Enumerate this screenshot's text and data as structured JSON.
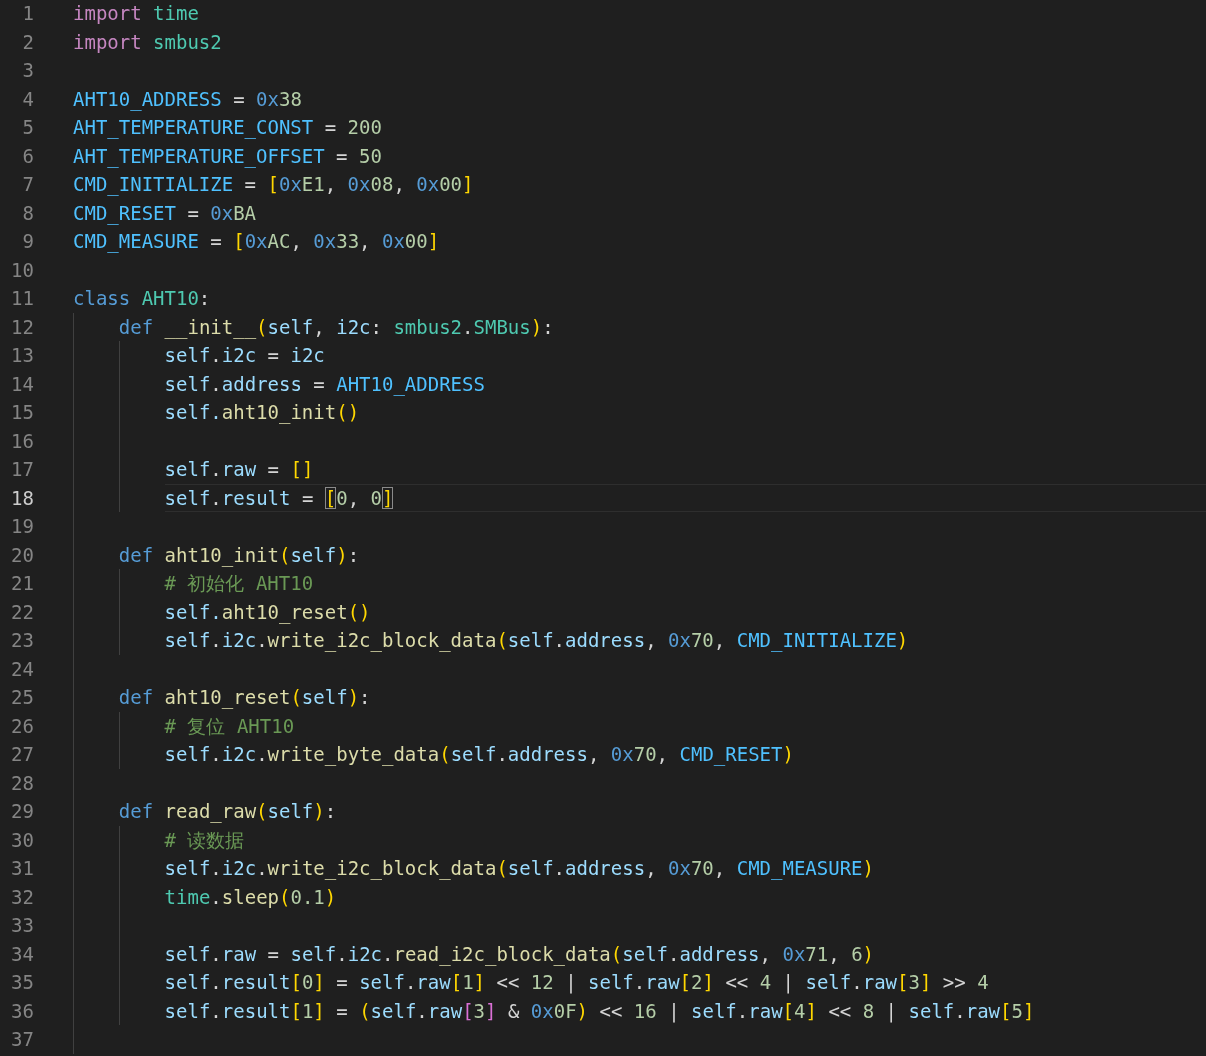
{
  "editor": {
    "lines": [
      {
        "number": "1",
        "current": false,
        "tokens": [
          {
            "kind": "k",
            "text": "import "
          },
          {
            "kind": "m",
            "text": "time"
          }
        ]
      },
      {
        "number": "2",
        "current": false,
        "tokens": [
          {
            "kind": "k",
            "text": "import "
          },
          {
            "kind": "m",
            "text": "smbus2"
          }
        ]
      },
      {
        "number": "3",
        "current": false
      },
      {
        "number": "4",
        "current": false,
        "tokens": [
          {
            "kind": "c",
            "text": "AHT10_ADDRESS"
          },
          {
            "kind": "p",
            "text": " = "
          },
          {
            "kind": "x",
            "text": "0x"
          },
          {
            "kind": "n",
            "text": "38"
          }
        ]
      },
      {
        "number": "5",
        "current": false,
        "tokens": [
          {
            "kind": "c",
            "text": "AHT_TEMPERATURE_CONST"
          },
          {
            "kind": "p",
            "text": " = "
          },
          {
            "kind": "n",
            "text": "200"
          }
        ]
      },
      {
        "number": "6",
        "current": false,
        "tokens": [
          {
            "kind": "c",
            "text": "AHT_TEMPERATURE_OFFSET"
          },
          {
            "kind": "p",
            "text": " = "
          },
          {
            "kind": "n",
            "text": "50"
          }
        ]
      },
      {
        "number": "7",
        "current": false,
        "tokens": [
          {
            "kind": "c",
            "text": "CMD_INITIALIZE"
          },
          {
            "kind": "p",
            "text": " = "
          },
          {
            "kind": "b1",
            "text": "["
          },
          {
            "kind": "x",
            "text": "0x"
          },
          {
            "kind": "n",
            "text": "E1"
          },
          {
            "kind": "p",
            "text": ", "
          },
          {
            "kind": "x",
            "text": "0x"
          },
          {
            "kind": "n",
            "text": "08"
          },
          {
            "kind": "p",
            "text": ", "
          },
          {
            "kind": "x",
            "text": "0x"
          },
          {
            "kind": "n",
            "text": "00"
          },
          {
            "kind": "b1",
            "text": "]"
          }
        ]
      },
      {
        "number": "8",
        "current": false,
        "tokens": [
          {
            "kind": "c",
            "text": "CMD_RESET"
          },
          {
            "kind": "p",
            "text": " = "
          },
          {
            "kind": "x",
            "text": "0x"
          },
          {
            "kind": "n",
            "text": "BA"
          }
        ]
      },
      {
        "number": "9",
        "current": false,
        "tokens": [
          {
            "kind": "c",
            "text": "CMD_MEASURE"
          },
          {
            "kind": "p",
            "text": " = "
          },
          {
            "kind": "b1",
            "text": "["
          },
          {
            "kind": "x",
            "text": "0x"
          },
          {
            "kind": "n",
            "text": "AC"
          },
          {
            "kind": "p",
            "text": ", "
          },
          {
            "kind": "x",
            "text": "0x"
          },
          {
            "kind": "n",
            "text": "33"
          },
          {
            "kind": "p",
            "text": ", "
          },
          {
            "kind": "x",
            "text": "0x"
          },
          {
            "kind": "n",
            "text": "00"
          },
          {
            "kind": "b1",
            "text": "]"
          }
        ]
      },
      {
        "number": "10",
        "current": false
      },
      {
        "number": "11",
        "current": false,
        "tokens": [
          {
            "kind": "s",
            "text": "class "
          },
          {
            "kind": "m",
            "text": "AHT10"
          },
          {
            "kind": "p",
            "text": ":"
          }
        ],
        "children": [
          {
            "number": "12",
            "current": false,
            "tokens": [
              {
                "kind": "s",
                "text": "def "
              },
              {
                "kind": "f",
                "text": "__init__"
              },
              {
                "kind": "b1",
                "text": "("
              },
              {
                "kind": "v",
                "text": "self"
              },
              {
                "kind": "p",
                "text": ", "
              },
              {
                "kind": "v",
                "text": "i2c"
              },
              {
                "kind": "p",
                "text": ": "
              },
              {
                "kind": "m",
                "text": "smbus2"
              },
              {
                "kind": "p",
                "text": "."
              },
              {
                "kind": "m",
                "text": "SMBus"
              },
              {
                "kind": "b1",
                "text": ")"
              },
              {
                "kind": "p",
                "text": ":"
              }
            ],
            "children": [
              {
                "number": "13",
                "current": false,
                "tokens": [
                  {
                    "kind": "v",
                    "text": "self"
                  },
                  {
                    "kind": "p",
                    "text": "."
                  },
                  {
                    "kind": "v",
                    "text": "i2c"
                  },
                  {
                    "kind": "p",
                    "text": " = "
                  },
                  {
                    "kind": "v",
                    "text": "i2c"
                  }
                ]
              },
              {
                "number": "14",
                "current": false,
                "tokens": [
                  {
                    "kind": "v",
                    "text": "self"
                  },
                  {
                    "kind": "p",
                    "text": "."
                  },
                  {
                    "kind": "v",
                    "text": "address"
                  },
                  {
                    "kind": "p",
                    "text": " = "
                  },
                  {
                    "kind": "c",
                    "text": "AHT10_ADDRESS"
                  }
                ]
              },
              {
                "number": "15",
                "current": false,
                "tokens": [
                  {
                    "kind": "v",
                    "text": "self."
                  },
                  {
                    "kind": "f",
                    "text": "aht10_init"
                  },
                  {
                    "kind": "b1",
                    "text": "()"
                  }
                ]
              },
              {
                "number": "16",
                "current": false
              },
              {
                "number": "17",
                "current": false,
                "tokens": [
                  {
                    "kind": "v",
                    "text": "self"
                  },
                  {
                    "kind": "p",
                    "text": "."
                  },
                  {
                    "kind": "v",
                    "text": "raw"
                  },
                  {
                    "kind": "p",
                    "text": " = "
                  },
                  {
                    "kind": "b1",
                    "text": "[]"
                  }
                ]
              },
              {
                "number": "18",
                "current": true,
                "tokens": [
                  {
                    "kind": "v",
                    "text": "self"
                  },
                  {
                    "kind": "p",
                    "text": "."
                  },
                  {
                    "kind": "v",
                    "text": "result"
                  },
                  {
                    "kind": "p",
                    "text": " = "
                  },
                  {
                    "kind": "b1",
                    "text": "[",
                    "matched": true
                  },
                  {
                    "kind": "n",
                    "text": "0"
                  },
                  {
                    "kind": "p",
                    "text": ", "
                  },
                  {
                    "kind": "n",
                    "text": "0"
                  },
                  {
                    "kind": "b1",
                    "text": "]",
                    "matched": true
                  }
                ]
              }
            ]
          },
          {
            "number": "19",
            "current": false
          },
          {
            "number": "20",
            "current": false,
            "tokens": [
              {
                "kind": "s",
                "text": "def "
              },
              {
                "kind": "f",
                "text": "aht10_init"
              },
              {
                "kind": "b1",
                "text": "("
              },
              {
                "kind": "v",
                "text": "self"
              },
              {
                "kind": "b1",
                "text": ")"
              },
              {
                "kind": "p",
                "text": ":"
              }
            ],
            "children": [
              {
                "number": "21",
                "current": false,
                "tokens": [
                  {
                    "kind": "cm",
                    "text": "# 初始化 AHT10"
                  }
                ]
              },
              {
                "number": "22",
                "current": false,
                "tokens": [
                  {
                    "kind": "v",
                    "text": "self."
                  },
                  {
                    "kind": "f",
                    "text": "aht10_reset"
                  },
                  {
                    "kind": "b1",
                    "text": "()"
                  }
                ]
              },
              {
                "number": "23",
                "current": false,
                "tokens": [
                  {
                    "kind": "v",
                    "text": "self"
                  },
                  {
                    "kind": "p",
                    "text": "."
                  },
                  {
                    "kind": "v",
                    "text": "i2c"
                  },
                  {
                    "kind": "p",
                    "text": "."
                  },
                  {
                    "kind": "f",
                    "text": "write_i2c_block_data"
                  },
                  {
                    "kind": "b1",
                    "text": "("
                  },
                  {
                    "kind": "v",
                    "text": "self"
                  },
                  {
                    "kind": "p",
                    "text": "."
                  },
                  {
                    "kind": "v",
                    "text": "address"
                  },
                  {
                    "kind": "p",
                    "text": ", "
                  },
                  {
                    "kind": "x",
                    "text": "0x"
                  },
                  {
                    "kind": "n",
                    "text": "70"
                  },
                  {
                    "kind": "p",
                    "text": ", "
                  },
                  {
                    "kind": "c",
                    "text": "CMD_INITIALIZE"
                  },
                  {
                    "kind": "b1",
                    "text": ")"
                  }
                ]
              }
            ]
          },
          {
            "number": "24",
            "current": false
          },
          {
            "number": "25",
            "current": false,
            "tokens": [
              {
                "kind": "s",
                "text": "def "
              },
              {
                "kind": "f",
                "text": "aht10_reset"
              },
              {
                "kind": "b1",
                "text": "("
              },
              {
                "kind": "v",
                "text": "self"
              },
              {
                "kind": "b1",
                "text": ")"
              },
              {
                "kind": "p",
                "text": ":"
              }
            ],
            "children": [
              {
                "number": "26",
                "current": false,
                "tokens": [
                  {
                    "kind": "cm",
                    "text": "# 复位 AHT10"
                  }
                ]
              },
              {
                "number": "27",
                "current": false,
                "tokens": [
                  {
                    "kind": "v",
                    "text": "self"
                  },
                  {
                    "kind": "p",
                    "text": "."
                  },
                  {
                    "kind": "v",
                    "text": "i2c"
                  },
                  {
                    "kind": "p",
                    "text": "."
                  },
                  {
                    "kind": "f",
                    "text": "write_byte_data"
                  },
                  {
                    "kind": "b1",
                    "text": "("
                  },
                  {
                    "kind": "v",
                    "text": "self"
                  },
                  {
                    "kind": "p",
                    "text": "."
                  },
                  {
                    "kind": "v",
                    "text": "address"
                  },
                  {
                    "kind": "p",
                    "text": ", "
                  },
                  {
                    "kind": "x",
                    "text": "0x"
                  },
                  {
                    "kind": "n",
                    "text": "70"
                  },
                  {
                    "kind": "p",
                    "text": ", "
                  },
                  {
                    "kind": "c",
                    "text": "CMD_RESET"
                  },
                  {
                    "kind": "b1",
                    "text": ")"
                  }
                ]
              }
            ]
          },
          {
            "number": "28",
            "current": false
          },
          {
            "number": "29",
            "current": false,
            "tokens": [
              {
                "kind": "s",
                "text": "def "
              },
              {
                "kind": "f",
                "text": "read_raw"
              },
              {
                "kind": "b1",
                "text": "("
              },
              {
                "kind": "v",
                "text": "self"
              },
              {
                "kind": "b1",
                "text": ")"
              },
              {
                "kind": "p",
                "text": ":"
              }
            ],
            "children": [
              {
                "number": "30",
                "current": false,
                "tokens": [
                  {
                    "kind": "cm",
                    "text": "# 读数据"
                  }
                ]
              },
              {
                "number": "31",
                "current": false,
                "tokens": [
                  {
                    "kind": "v",
                    "text": "self"
                  },
                  {
                    "kind": "p",
                    "text": "."
                  },
                  {
                    "kind": "v",
                    "text": "i2c"
                  },
                  {
                    "kind": "p",
                    "text": "."
                  },
                  {
                    "kind": "f",
                    "text": "write_i2c_block_data"
                  },
                  {
                    "kind": "b1",
                    "text": "("
                  },
                  {
                    "kind": "v",
                    "text": "self"
                  },
                  {
                    "kind": "p",
                    "text": "."
                  },
                  {
                    "kind": "v",
                    "text": "address"
                  },
                  {
                    "kind": "p",
                    "text": ", "
                  },
                  {
                    "kind": "x",
                    "text": "0x"
                  },
                  {
                    "kind": "n",
                    "text": "70"
                  },
                  {
                    "kind": "p",
                    "text": ", "
                  },
                  {
                    "kind": "c",
                    "text": "CMD_MEASURE"
                  },
                  {
                    "kind": "b1",
                    "text": ")"
                  }
                ]
              },
              {
                "number": "32",
                "current": false,
                "tokens": [
                  {
                    "kind": "m",
                    "text": "time"
                  },
                  {
                    "kind": "p",
                    "text": "."
                  },
                  {
                    "kind": "f",
                    "text": "sleep"
                  },
                  {
                    "kind": "b1",
                    "text": "("
                  },
                  {
                    "kind": "n",
                    "text": "0.1"
                  },
                  {
                    "kind": "b1",
                    "text": ")"
                  }
                ]
              },
              {
                "number": "33",
                "current": false
              },
              {
                "number": "34",
                "current": false,
                "tokens": [
                  {
                    "kind": "v",
                    "text": "self"
                  },
                  {
                    "kind": "p",
                    "text": "."
                  },
                  {
                    "kind": "v",
                    "text": "raw"
                  },
                  {
                    "kind": "p",
                    "text": " = "
                  },
                  {
                    "kind": "v",
                    "text": "self"
                  },
                  {
                    "kind": "p",
                    "text": "."
                  },
                  {
                    "kind": "v",
                    "text": "i2c"
                  },
                  {
                    "kind": "p",
                    "text": "."
                  },
                  {
                    "kind": "f",
                    "text": "read_i2c_block_data"
                  },
                  {
                    "kind": "b1",
                    "text": "("
                  },
                  {
                    "kind": "v",
                    "text": "self"
                  },
                  {
                    "kind": "p",
                    "text": "."
                  },
                  {
                    "kind": "v",
                    "text": "address"
                  },
                  {
                    "kind": "p",
                    "text": ", "
                  },
                  {
                    "kind": "x",
                    "text": "0x"
                  },
                  {
                    "kind": "n",
                    "text": "71"
                  },
                  {
                    "kind": "p",
                    "text": ", "
                  },
                  {
                    "kind": "n",
                    "text": "6"
                  },
                  {
                    "kind": "b1",
                    "text": ")"
                  }
                ]
              },
              {
                "number": "35",
                "current": false,
                "tokens": [
                  {
                    "kind": "v",
                    "text": "self"
                  },
                  {
                    "kind": "p",
                    "text": "."
                  },
                  {
                    "kind": "v",
                    "text": "result"
                  },
                  {
                    "kind": "b1",
                    "text": "["
                  },
                  {
                    "kind": "n",
                    "text": "0"
                  },
                  {
                    "kind": "b1",
                    "text": "]"
                  },
                  {
                    "kind": "p",
                    "text": " = "
                  },
                  {
                    "kind": "v",
                    "text": "self"
                  },
                  {
                    "kind": "p",
                    "text": "."
                  },
                  {
                    "kind": "v",
                    "text": "raw"
                  },
                  {
                    "kind": "b1",
                    "text": "["
                  },
                  {
                    "kind": "n",
                    "text": "1"
                  },
                  {
                    "kind": "b1",
                    "text": "]"
                  },
                  {
                    "kind": "p",
                    "text": " << "
                  },
                  {
                    "kind": "n",
                    "text": "12"
                  },
                  {
                    "kind": "p",
                    "text": " | "
                  },
                  {
                    "kind": "v",
                    "text": "self"
                  },
                  {
                    "kind": "p",
                    "text": "."
                  },
                  {
                    "kind": "v",
                    "text": "raw"
                  },
                  {
                    "kind": "b1",
                    "text": "["
                  },
                  {
                    "kind": "n",
                    "text": "2"
                  },
                  {
                    "kind": "b1",
                    "text": "]"
                  },
                  {
                    "kind": "p",
                    "text": " << "
                  },
                  {
                    "kind": "n",
                    "text": "4"
                  },
                  {
                    "kind": "p",
                    "text": " | "
                  },
                  {
                    "kind": "v",
                    "text": "self"
                  },
                  {
                    "kind": "p",
                    "text": "."
                  },
                  {
                    "kind": "v",
                    "text": "raw"
                  },
                  {
                    "kind": "b1",
                    "text": "["
                  },
                  {
                    "kind": "n",
                    "text": "3"
                  },
                  {
                    "kind": "b1",
                    "text": "]"
                  },
                  {
                    "kind": "p",
                    "text": " >> "
                  },
                  {
                    "kind": "n",
                    "text": "4"
                  }
                ]
              },
              {
                "number": "36",
                "current": false,
                "tokens": [
                  {
                    "kind": "v",
                    "text": "self"
                  },
                  {
                    "kind": "p",
                    "text": "."
                  },
                  {
                    "kind": "v",
                    "text": "result"
                  },
                  {
                    "kind": "b1",
                    "text": "["
                  },
                  {
                    "kind": "n",
                    "text": "1"
                  },
                  {
                    "kind": "b1",
                    "text": "]"
                  },
                  {
                    "kind": "p",
                    "text": " = "
                  },
                  {
                    "kind": "b1",
                    "text": "("
                  },
                  {
                    "kind": "v",
                    "text": "self"
                  },
                  {
                    "kind": "p",
                    "text": "."
                  },
                  {
                    "kind": "v",
                    "text": "raw"
                  },
                  {
                    "kind": "b2",
                    "text": "["
                  },
                  {
                    "kind": "n",
                    "text": "3"
                  },
                  {
                    "kind": "b2",
                    "text": "]"
                  },
                  {
                    "kind": "p",
                    "text": " & "
                  },
                  {
                    "kind": "x",
                    "text": "0x"
                  },
                  {
                    "kind": "n",
                    "text": "0F"
                  },
                  {
                    "kind": "b1",
                    "text": ")"
                  },
                  {
                    "kind": "p",
                    "text": " << "
                  },
                  {
                    "kind": "n",
                    "text": "16"
                  },
                  {
                    "kind": "p",
                    "text": " | "
                  },
                  {
                    "kind": "v",
                    "text": "self"
                  },
                  {
                    "kind": "p",
                    "text": "."
                  },
                  {
                    "kind": "v",
                    "text": "raw"
                  },
                  {
                    "kind": "b1",
                    "text": "["
                  },
                  {
                    "kind": "n",
                    "text": "4"
                  },
                  {
                    "kind": "b1",
                    "text": "]"
                  },
                  {
                    "kind": "p",
                    "text": " << "
                  },
                  {
                    "kind": "n",
                    "text": "8"
                  },
                  {
                    "kind": "p",
                    "text": " | "
                  },
                  {
                    "kind": "v",
                    "text": "self"
                  },
                  {
                    "kind": "p",
                    "text": "."
                  },
                  {
                    "kind": "v",
                    "text": "raw"
                  },
                  {
                    "kind": "b1",
                    "text": "["
                  },
                  {
                    "kind": "n",
                    "text": "5"
                  },
                  {
                    "kind": "b1",
                    "text": "]"
                  }
                ]
              }
            ]
          },
          {
            "number": "37",
            "current": false
          }
        ]
      }
    ]
  }
}
